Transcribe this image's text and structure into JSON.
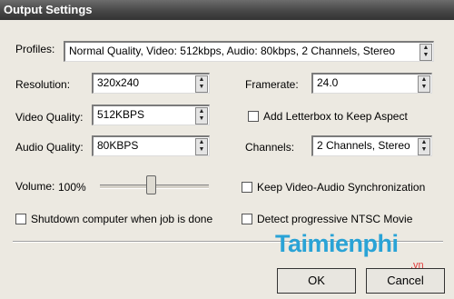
{
  "title": "Output Settings",
  "labels": {
    "profiles": "Profiles:",
    "resolution": "Resolution:",
    "framerate": "Framerate:",
    "video_quality": "Video Quality:",
    "audio_quality": "Audio Quality:",
    "channels": "Channels:",
    "volume": "Volume:",
    "volume_value": "100%"
  },
  "fields": {
    "profile": "Normal Quality,    Video: 512kbps,  Audio: 80kbps,  2 Channels, Stereo",
    "resolution": "320x240",
    "framerate": "24.0",
    "video_quality": "512KBPS",
    "audio_quality": "80KBPS",
    "channels": "2 Channels, Stereo"
  },
  "volume_level": 1.0,
  "checkboxes": {
    "letterbox": "Add Letterbox to Keep Aspect",
    "sync": "Keep Video-Audio Synchronization",
    "shutdown": "Shutdown computer when job is done",
    "ntsc": "Detect progressive NTSC Movie"
  },
  "buttons": {
    "ok": "OK",
    "cancel": "Cancel"
  },
  "watermark": {
    "brand": "Taimienphi",
    "suffix": ".vn"
  }
}
